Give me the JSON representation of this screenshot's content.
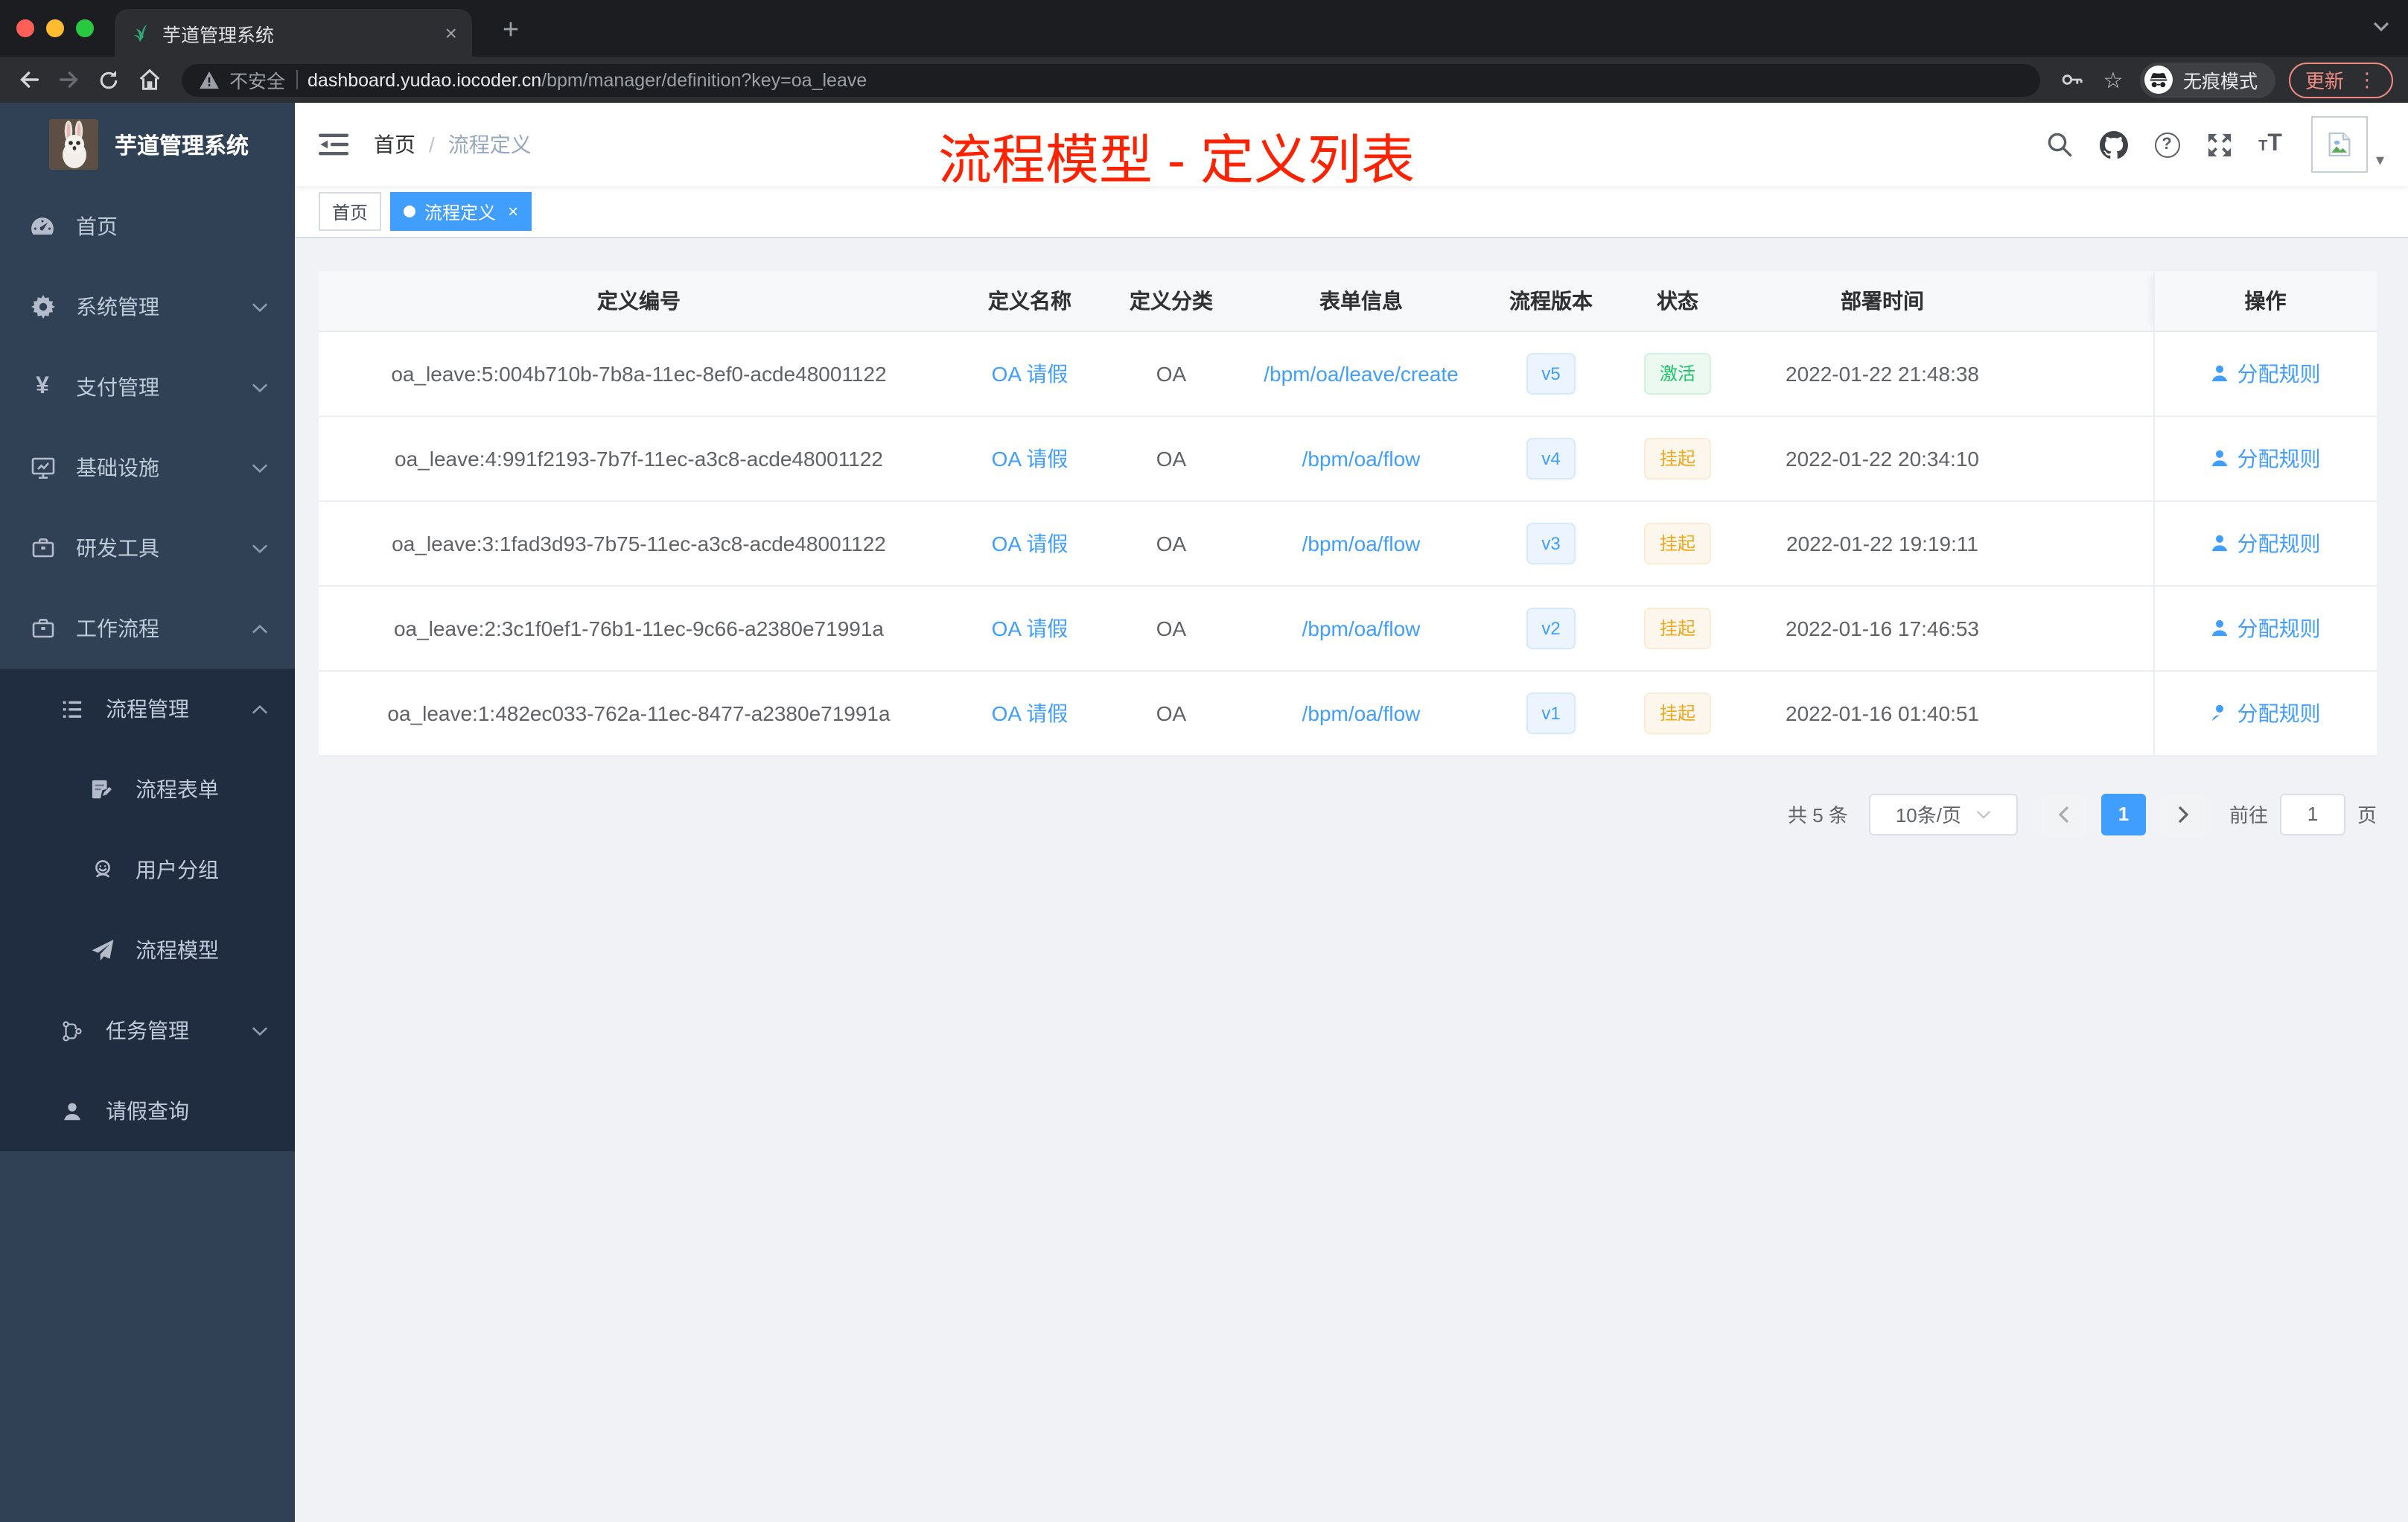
{
  "browser": {
    "tab": {
      "title": "芋道管理系统"
    },
    "toolbar": {
      "security_label": "不安全",
      "url_host": "dashboard.yudao.iocoder.cn",
      "url_path": "/bpm/manager/definition?key=oa_leave",
      "incognito_label": "无痕模式",
      "update_label": "更新"
    }
  },
  "icons": {
    "close_glyph": "×",
    "plus_glyph": "+",
    "star_glyph": "☆",
    "menu_dots_glyph": "⋮",
    "caret_down_glyph": "▾",
    "yen_glyph": "¥",
    "help_glyph": "?",
    "fontsize_small": "T",
    "fontsize_large": "T"
  },
  "sidebar": {
    "logo_title": "芋道管理系统",
    "items": [
      {
        "label": "首页"
      },
      {
        "label": "系统管理"
      },
      {
        "label": "支付管理"
      },
      {
        "label": "基础设施"
      },
      {
        "label": "研发工具"
      },
      {
        "label": "工作流程"
      },
      {
        "label": "流程管理"
      },
      {
        "label": "流程表单"
      },
      {
        "label": "用户分组"
      },
      {
        "label": "流程模型"
      },
      {
        "label": "任务管理"
      },
      {
        "label": "请假查询"
      }
    ]
  },
  "navbar": {
    "breadcrumb": {
      "home": "首页",
      "separator": "/",
      "current": "流程定义"
    }
  },
  "annotation": {
    "text": "流程模型 - 定义列表",
    "color": "#ff2200"
  },
  "tags": [
    {
      "label": "首页",
      "active": false
    },
    {
      "label": "流程定义",
      "active": true
    }
  ],
  "table": {
    "columns": [
      "定义编号",
      "定义名称",
      "定义分类",
      "表单信息",
      "流程版本",
      "状态",
      "部署时间",
      "操作"
    ],
    "rows": [
      {
        "id": "oa_leave:5:004b710b-7b8a-11ec-8ef0-acde48001122",
        "name": "OA 请假",
        "category": "OA",
        "form": "/bpm/oa/leave/create",
        "version": "v5",
        "status": "激活",
        "status_type": "success",
        "deploy_time": "2022-01-22 21:48:38",
        "action": "分配规则"
      },
      {
        "id": "oa_leave:4:991f2193-7b7f-11ec-a3c8-acde48001122",
        "name": "OA 请假",
        "category": "OA",
        "form": "/bpm/oa/flow",
        "version": "v4",
        "status": "挂起",
        "status_type": "warning",
        "deploy_time": "2022-01-22 20:34:10",
        "action": "分配规则"
      },
      {
        "id": "oa_leave:3:1fad3d93-7b75-11ec-a3c8-acde48001122",
        "name": "OA 请假",
        "category": "OA",
        "form": "/bpm/oa/flow",
        "version": "v3",
        "status": "挂起",
        "status_type": "warning",
        "deploy_time": "2022-01-22 19:19:11",
        "action": "分配规则"
      },
      {
        "id": "oa_leave:2:3c1f0ef1-76b1-11ec-9c66-a2380e71991a",
        "name": "OA 请假",
        "category": "OA",
        "form": "/bpm/oa/flow",
        "version": "v2",
        "status": "挂起",
        "status_type": "warning",
        "deploy_time": "2022-01-16 17:46:53",
        "action": "分配规则"
      },
      {
        "id": "oa_leave:1:482ec033-762a-11ec-8477-a2380e71991a",
        "name": "OA 请假",
        "category": "OA",
        "form": "/bpm/oa/flow",
        "version": "v1",
        "status": "挂起",
        "status_type": "warning",
        "deploy_time": "2022-01-16 01:40:51",
        "action": "分配规则"
      }
    ]
  },
  "pagination": {
    "total": "共 5 条",
    "page_size": "10条/页",
    "current_page": "1",
    "jump_prefix": "前往",
    "jump_value": "1",
    "jump_suffix": "页"
  },
  "colors": {
    "accent": "#409eff",
    "success": "#1dc26a",
    "warning": "#f0a91e",
    "annotation_red": "#ff2200",
    "sidebar_bg": "#304156",
    "submenu_bg": "#202d40"
  }
}
